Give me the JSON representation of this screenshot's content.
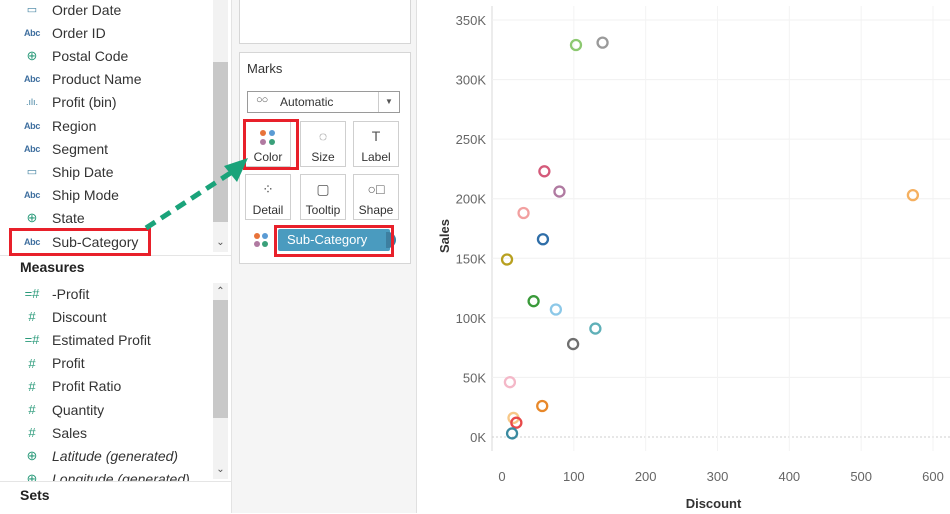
{
  "dimensions": [
    {
      "name": "Order Date",
      "icon": "calendar-icon",
      "glyph": "▭"
    },
    {
      "name": "Order ID",
      "icon": "abc-icon",
      "glyph": "Abc"
    },
    {
      "name": "Postal Code",
      "icon": "globe-icon",
      "glyph": "⊕"
    },
    {
      "name": "Product Name",
      "icon": "abc-icon",
      "glyph": "Abc"
    },
    {
      "name": "Profit (bin)",
      "icon": "bin-icon",
      "glyph": ".ılı."
    },
    {
      "name": "Region",
      "icon": "abc-icon",
      "glyph": "Abc"
    },
    {
      "name": "Segment",
      "icon": "abc-icon",
      "glyph": "Abc"
    },
    {
      "name": "Ship Date",
      "icon": "calendar-icon",
      "glyph": "▭"
    },
    {
      "name": "Ship Mode",
      "icon": "abc-icon",
      "glyph": "Abc"
    },
    {
      "name": "State",
      "icon": "globe-icon",
      "glyph": "⊕"
    },
    {
      "name": "Sub-Category",
      "icon": "abc-icon",
      "glyph": "Abc"
    }
  ],
  "measures_header": "Measures",
  "measures": [
    {
      "name": "-Profit",
      "icon": "calculated-measure-icon",
      "glyph": "=#"
    },
    {
      "name": "Discount",
      "icon": "measure-icon",
      "glyph": "#"
    },
    {
      "name": "Estimated Profit",
      "icon": "calculated-measure-icon",
      "glyph": "=#"
    },
    {
      "name": "Profit",
      "icon": "measure-icon",
      "glyph": "#"
    },
    {
      "name": "Profit Ratio",
      "icon": "measure-icon",
      "glyph": "#"
    },
    {
      "name": "Quantity",
      "icon": "measure-icon",
      "glyph": "#"
    },
    {
      "name": "Sales",
      "icon": "measure-icon",
      "glyph": "#"
    },
    {
      "name": "Latitude (generated)",
      "icon": "globe-icon",
      "glyph": "⊕",
      "italic": true
    },
    {
      "name": "Longitude (generated)",
      "icon": "globe-icon",
      "glyph": "⊕",
      "italic": true
    }
  ],
  "sets_header": "Sets",
  "marks": {
    "title": "Marks",
    "mark_type": "Automatic",
    "buttons": [
      {
        "label": "Color",
        "icon": "color-icon"
      },
      {
        "label": "Size",
        "icon": "size-icon",
        "glyph": "◌"
      },
      {
        "label": "Label",
        "icon": "label-icon",
        "glyph": "T"
      },
      {
        "label": "Detail",
        "icon": "detail-icon",
        "glyph": "⁘"
      },
      {
        "label": "Tooltip",
        "icon": "tooltip-icon",
        "glyph": "▢"
      },
      {
        "label": "Shape",
        "icon": "shape-icon",
        "glyph": "○□"
      }
    ],
    "color_pill": "Sub-Category"
  },
  "colors": {
    "highlight": "#e8202a",
    "arrow": "#1aa37a",
    "pill": "#4a9bbf"
  },
  "chart_data": {
    "type": "scatter",
    "xlabel": "Discount",
    "ylabel": "Sales",
    "xlim": [
      0,
      600
    ],
    "ylim": [
      0,
      350000
    ],
    "x_ticks": [
      "0",
      "100",
      "200",
      "300",
      "400",
      "500",
      "600"
    ],
    "y_ticks": [
      "0K",
      "50K",
      "100K",
      "150K",
      "200K",
      "250K",
      "300K",
      "350K"
    ],
    "marker": "hollow-circle",
    "points": [
      {
        "x": 103,
        "y": 329000,
        "color": "#8cc870"
      },
      {
        "x": 140,
        "y": 331000,
        "color": "#9a9a9a"
      },
      {
        "x": 59,
        "y": 223000,
        "color": "#d45a7a"
      },
      {
        "x": 80,
        "y": 206000,
        "color": "#b07aa1"
      },
      {
        "x": 30,
        "y": 188000,
        "color": "#f2a0a0"
      },
      {
        "x": 572,
        "y": 203000,
        "color": "#f5b060"
      },
      {
        "x": 57,
        "y": 166000,
        "color": "#2f6ea8"
      },
      {
        "x": 7,
        "y": 149000,
        "color": "#b8a020"
      },
      {
        "x": 44,
        "y": 114000,
        "color": "#3a9a3a"
      },
      {
        "x": 75,
        "y": 107000,
        "color": "#8cc8e8"
      },
      {
        "x": 130,
        "y": 91000,
        "color": "#5fb0b8"
      },
      {
        "x": 99,
        "y": 78000,
        "color": "#6f6f6f"
      },
      {
        "x": 11,
        "y": 46000,
        "color": "#f4b8c8"
      },
      {
        "x": 56,
        "y": 26000,
        "color": "#e8882a"
      },
      {
        "x": 16,
        "y": 16000,
        "color": "#f7c888"
      },
      {
        "x": 20,
        "y": 12000,
        "color": "#e84a4a"
      },
      {
        "x": 14,
        "y": 3000,
        "color": "#3a8aa0"
      }
    ]
  }
}
